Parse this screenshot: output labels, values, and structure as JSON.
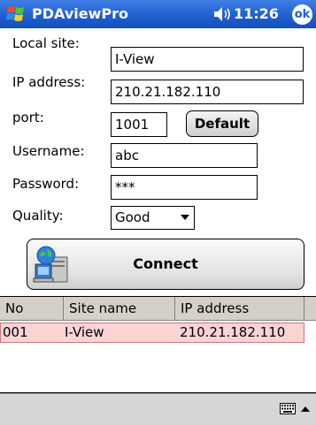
{
  "titlebar": {
    "app_name": "PDAviewPro",
    "time": "11:26",
    "ok_label": "ok"
  },
  "form": {
    "local_site_label": "Local site:",
    "local_site_value": "I-View",
    "ip_label": "IP address:",
    "ip_value": "210.21.182.110",
    "port_label": "port:",
    "port_value": "1001",
    "default_label": "Default",
    "username_label": "Username:",
    "username_value": "abc",
    "password_label": "Password:",
    "password_value": "***",
    "quality_label": "Quality:",
    "quality_value": "Good"
  },
  "connect_label": "Connect",
  "table": {
    "columns": [
      "No",
      "Site name",
      "IP address"
    ],
    "rows": [
      {
        "no": "001",
        "site": "I-View",
        "ip": "210.21.182.110"
      }
    ]
  },
  "colors": {
    "titlebar": "#1f5fd0",
    "selected_row": "#fbd3d3"
  }
}
